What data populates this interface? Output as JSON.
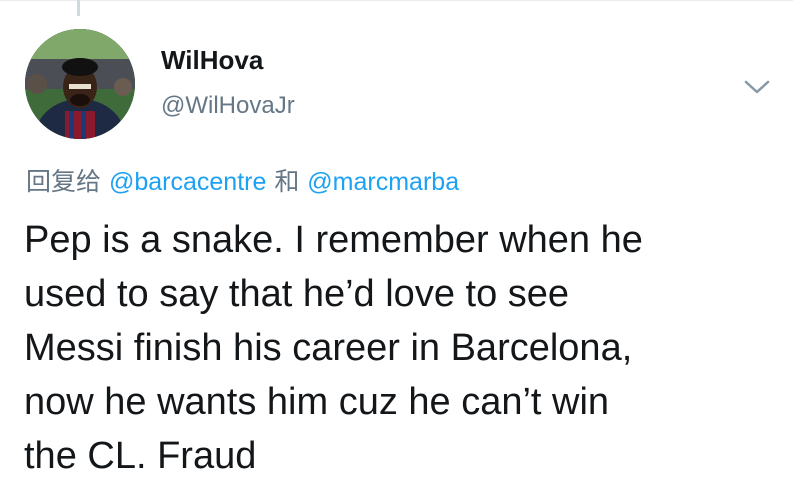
{
  "tweet": {
    "author": {
      "display_name": "WilHova",
      "handle": "@WilHovaJr",
      "avatar_icon": "user-avatar-photo"
    },
    "menu_icon": "chevron-down-icon",
    "reply_context": {
      "prefix": "回复给",
      "mentions": [
        "@barcacentre",
        "@marcmarba"
      ],
      "conjunction": "和"
    },
    "text_lines": [
      "Pep is a snake. I remember when he",
      "used to say that he’d love to see",
      "Messi finish his career in Barcelona,",
      "now he wants him cuz he can’t win",
      "the CL. Fraud"
    ]
  },
  "colors": {
    "link": "#1da1f2",
    "secondary_text": "#657786",
    "primary_text": "#14171a"
  }
}
